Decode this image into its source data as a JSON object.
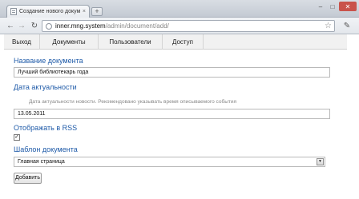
{
  "browser": {
    "tab_title": "Создание нового докуме...",
    "tab_close": "×",
    "new_tab": "+",
    "window_controls": {
      "minimize": "–",
      "maximize": "□",
      "close": "✕"
    },
    "nav": {
      "back": "←",
      "forward": "→",
      "reload": "↻"
    },
    "address": {
      "host": "inner.mng.system",
      "path": "/admin/document/add/"
    },
    "icons": [
      "page-icon",
      "globe-icon",
      "star-icon",
      "wrench-icon"
    ]
  },
  "menu": {
    "items": [
      {
        "label": "Выход"
      },
      {
        "label": "Документы"
      },
      {
        "label": "Пользователи"
      },
      {
        "label": "Доступ"
      }
    ]
  },
  "form": {
    "title": {
      "label": "Название документа",
      "value": "Лучший библиотекарь года"
    },
    "date": {
      "label": "Дата актуальности",
      "hint": "Дата актуальности новости. Рекомендовано указывать время описываемого события",
      "value": "13.05.2011"
    },
    "rss": {
      "label": "Отображать в RSS",
      "checked": true,
      "check_mark": "✓"
    },
    "template": {
      "label": "Шаблон документа",
      "selected": "Главная страница"
    },
    "submit_label": "Добавить"
  },
  "colors": {
    "label_blue": "#1e5aa8",
    "hint_gray": "#888888"
  }
}
